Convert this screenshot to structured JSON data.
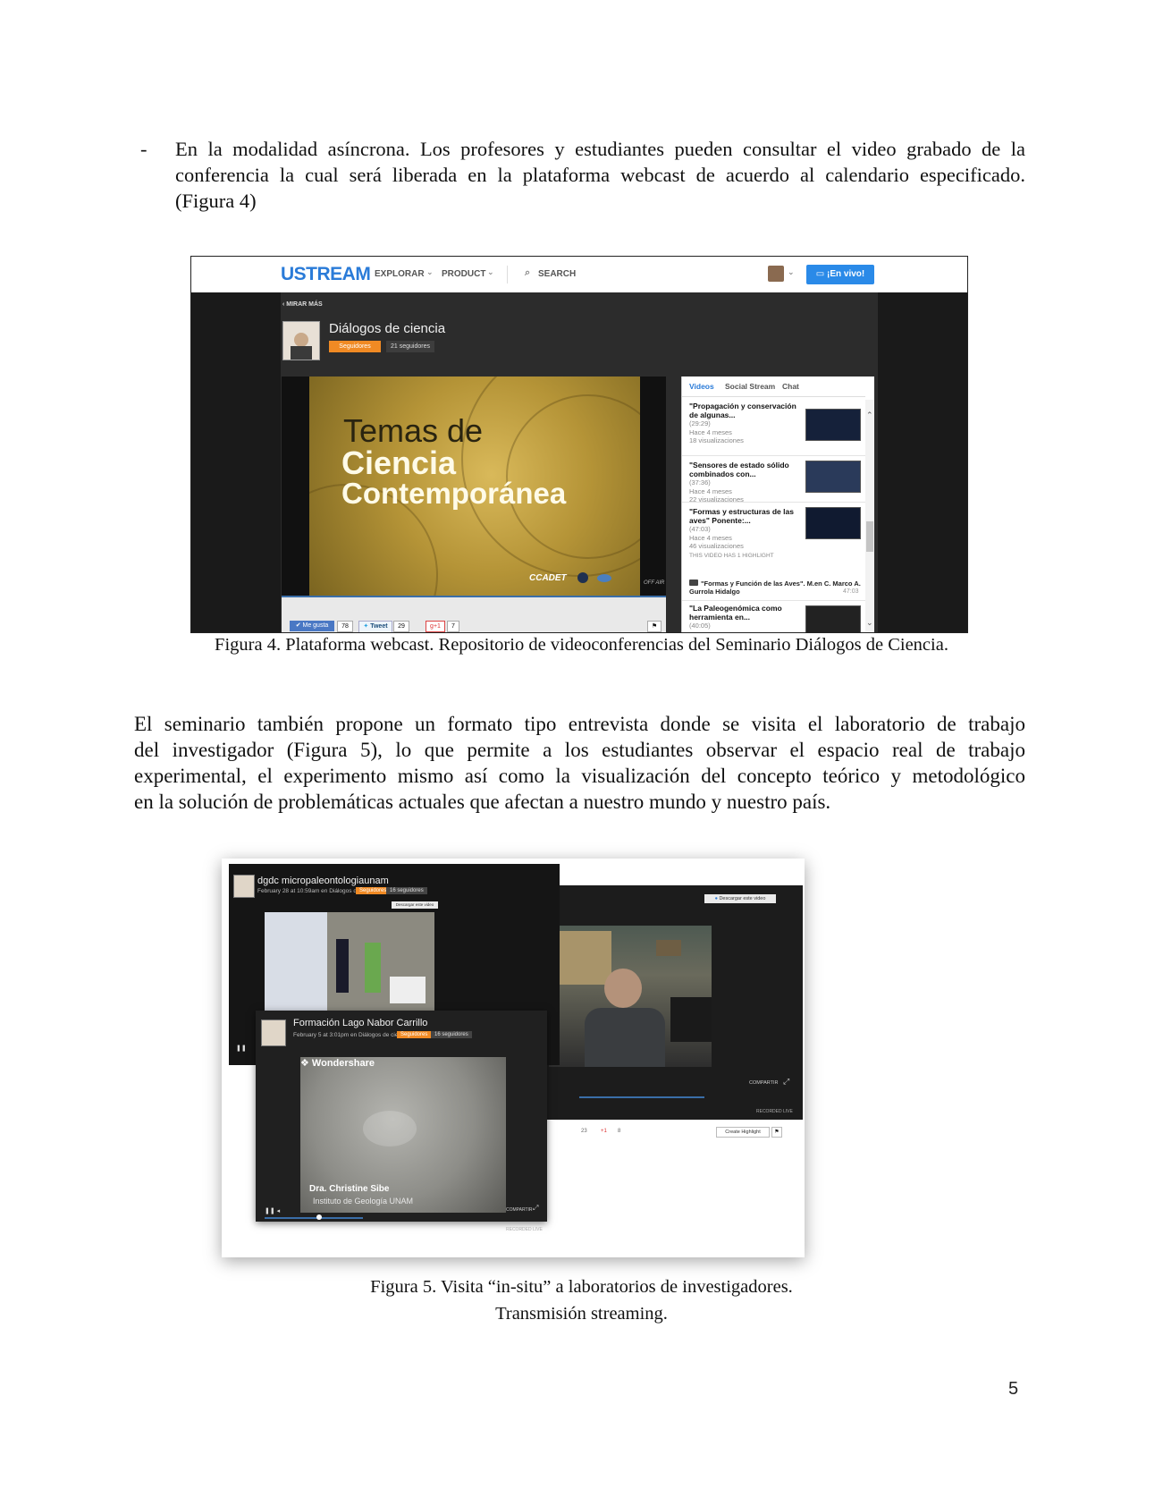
{
  "bullet": {
    "marker": "-",
    "line1": "En la modalidad asíncrona. Los profesores y estudiantes pueden consultar el video grabado de la",
    "line2": "conferencia la cual será liberada en la plataforma webcast de acuerdo al calendario especificado.",
    "line3": "(Figura 4)"
  },
  "figure4": {
    "caption": "Figura 4. Plataforma webcast. Repositorio de videoconferencias del Seminario Diálogos de Ciencia.",
    "topbar": {
      "logo": "USTREAM",
      "nav": [
        "EXPLORAR",
        "PRODUCT",
        "SEARCH"
      ],
      "live_button": "¡En vivo!"
    },
    "back_link": "MIRAR MÁS",
    "channel": {
      "title": "Diálogos de ciencia",
      "follow_button": "Seguidores",
      "followers": "21 seguidores"
    },
    "player": {
      "poster_line1": "Temas de",
      "poster_line2": "Ciencia",
      "poster_line3": "Contemporánea",
      "poster_logo": "CCADET",
      "status": "OFF AIR"
    },
    "social": {
      "like": "Me gusta",
      "like_count": "78",
      "tweet": "Tweet",
      "tweet_count": "29",
      "gplus": "+1",
      "gplus_count": "7"
    },
    "panel": {
      "tabs": [
        "Videos",
        "Social Stream",
        "Chat"
      ],
      "videos": [
        {
          "title": "\"Propagación y conservación de algunas...",
          "duration": "(29:29)",
          "age": "Hace 4 meses",
          "views": "18 visualizaciones"
        },
        {
          "title": "\"Sensores de estado sólido combinados con...",
          "duration": "(37:36)",
          "age": "Hace 4 meses",
          "views": "22 visualizaciones"
        },
        {
          "title": "\"Formas y estructuras de las aves\" Ponente:...",
          "duration": "(47:03)",
          "age": "Hace 4 meses",
          "views": "46 visualizaciones"
        }
      ],
      "highlight_label": "THIS VIDEO HAS 1 HIGHLIGHT",
      "highlight_title": "\"Formas y Función de las Aves\". M.en C. Marco A. Gurrola Hidalgo",
      "highlight_time": "47:03",
      "last_video": {
        "title": "\"La Paleogenómica como herramienta en...",
        "duration": "(40:05)"
      }
    }
  },
  "paragraph": {
    "line1": "El seminario también propone un formato tipo entrevista donde se visita el laboratorio de trabajo",
    "line2": "del investigador (Figura 5), lo que permite a los estudiantes observar el espacio real de trabajo",
    "line3": "experimental, el experimento mismo así como la visualización del concepto teórico y metodológico",
    "line4": "en la solución de problemáticas actuales que afectan a nuestro mundo y nuestro país."
  },
  "figure5": {
    "caption_line1": "Figura 5. Visita “in-situ” a laboratorios de investigadores.",
    "caption_line2": "Transmisión streaming.",
    "window_a": {
      "title": "dgdc micropaleontologiaunam",
      "subtitle": "February 28 at 10:59am en Diálogos de ciencia",
      "follow": "Seguidores",
      "followers": "16 seguidores",
      "download": "Descargar este video"
    },
    "window_b": {
      "download": "Descargar este video",
      "share": "COMPARTIR",
      "status": "RECORDED LIVE",
      "counts": "23",
      "gplus": "+1",
      "gplus_count": "8",
      "highlight": "Create Highlight"
    },
    "window_c": {
      "title": "Formación Lago Nabor Carrillo",
      "subtitle": "February 5 at 3:01pm en Diálogos de ciencia",
      "follow": "Seguidores",
      "followers": "16 seguidores",
      "watermark": "Wondershare",
      "overlay_name": "Dra. Christine Sibe",
      "overlay_inst": "Instituto de Geología UNAM",
      "share": "COMPARTIR",
      "status": "RECORDED LIVE"
    }
  },
  "page_number": "5"
}
